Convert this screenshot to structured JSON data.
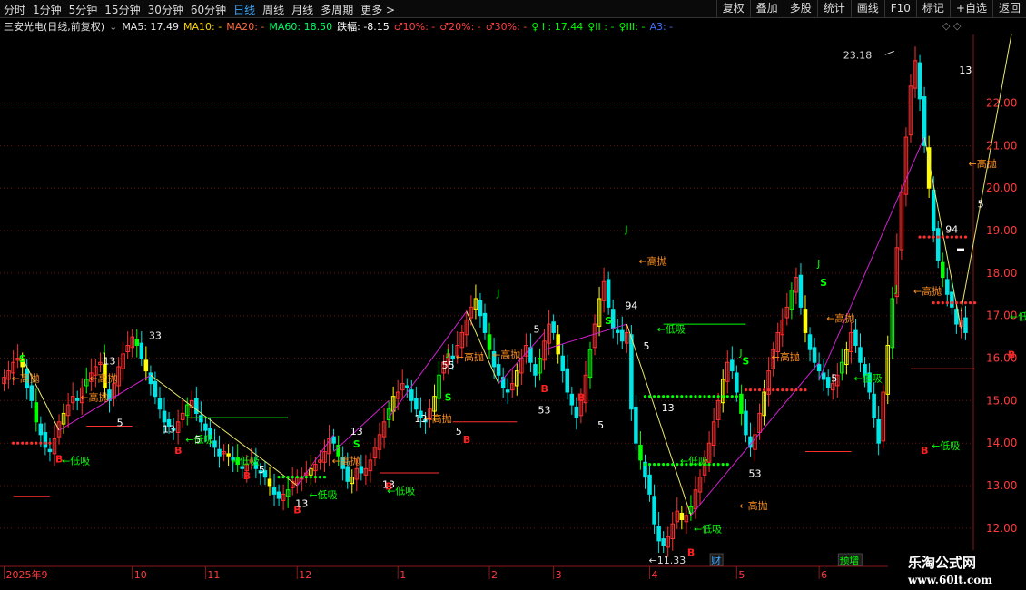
{
  "toolbar": {
    "period_tabs": [
      "分时",
      "1分钟",
      "5分钟",
      "15分钟",
      "30分钟",
      "60分钟",
      "日线",
      "周线",
      "月线",
      "多周期",
      "更多 >"
    ],
    "active_tab": "日线",
    "right_buttons": [
      "复权",
      "叠加",
      "多股",
      "统计",
      "画线",
      "F10",
      "标记",
      "+自选",
      "返回"
    ]
  },
  "info": {
    "stock_title": "三安光电(日线,前复权)",
    "ma5": "MA5: 17.49",
    "ma10": "MA10: -",
    "ma20": "MA20: -",
    "ma60": "MA60: 18.50",
    "change": "跌幅: -8.15",
    "f10": "♂10%: -",
    "f20": "♂20%: -",
    "f30": "♂30%: -",
    "l1": "♀ I : 17.44",
    "l2": "♀II : -",
    "l3": "♀III: -",
    "a3": "A3: -",
    "corner_icons": "◇ ◇"
  },
  "colors": {
    "up": "#ff3030",
    "down": "#00e5e5",
    "yellow": "#ffff00",
    "green": "#00ff00",
    "magenta": "#d020d0",
    "grid": "#6a1010",
    "orange": "#ff9020"
  },
  "chart_data": {
    "type": "candlestick",
    "ylim": [
      11.1,
      23.4
    ],
    "yticks": [
      12.0,
      13.0,
      14.0,
      15.0,
      16.0,
      17.0,
      18.0,
      19.0,
      20.0,
      21.0,
      22.0
    ],
    "ytick_labels": [
      "12.00",
      "13.00",
      "14.00",
      "15.00",
      "16.00",
      "17.00",
      "18.00",
      "19.00",
      "20.00",
      "21.00",
      "22.00"
    ],
    "x_labels": [
      {
        "i": 0,
        "label": "2025年9"
      },
      {
        "i": 28,
        "label": "10"
      },
      {
        "i": 44,
        "label": "11"
      },
      {
        "i": 64,
        "label": "12"
      },
      {
        "i": 86,
        "label": "1"
      },
      {
        "i": 106,
        "label": "2"
      },
      {
        "i": 120,
        "label": "3"
      },
      {
        "i": 141,
        "label": "4"
      },
      {
        "i": 160,
        "label": "5"
      },
      {
        "i": 178,
        "label": "6"
      }
    ],
    "bottom_tags": [
      {
        "i": 155,
        "label": "财",
        "color": "#3fa9ff"
      },
      {
        "i": 183,
        "label": "预增",
        "color": "#00ff00"
      }
    ],
    "high_label": {
      "i": 194,
      "text": "23.18"
    },
    "low_label": {
      "i": 140,
      "text": "11.33"
    },
    "closes": [
      15.55,
      15.7,
      15.9,
      16.0,
      15.8,
      15.3,
      15.0,
      14.5,
      14.2,
      13.9,
      13.8,
      14.1,
      14.5,
      14.7,
      14.9,
      15.1,
      15.0,
      15.3,
      15.5,
      15.65,
      15.8,
      15.9,
      15.3,
      15.0,
      15.4,
      15.8,
      16.1,
      16.3,
      16.5,
      16.3,
      16.0,
      15.7,
      15.4,
      15.1,
      14.8,
      14.5,
      14.4,
      14.3,
      14.5,
      14.7,
      14.9,
      15.0,
      14.7,
      14.5,
      14.3,
      14.1,
      13.9,
      13.7,
      13.8,
      13.7,
      13.6,
      13.5,
      13.4,
      13.5,
      13.6,
      13.4,
      13.3,
      13.2,
      13.0,
      12.8,
      12.7,
      12.8,
      12.9,
      13.1,
      13.2,
      13.2,
      13.3,
      13.4,
      13.5,
      13.6,
      13.8,
      14.1,
      14.0,
      13.7,
      13.4,
      13.1,
      13.2,
      13.4,
      13.3,
      13.4,
      13.6,
      13.9,
      14.2,
      14.5,
      14.8,
      15.1,
      15.2,
      15.4,
      15.3,
      15.0,
      14.8,
      14.6,
      14.5,
      14.8,
      15.1,
      15.6,
      15.9,
      16.1,
      16.0,
      16.3,
      16.6,
      16.9,
      17.2,
      17.4,
      17.0,
      16.6,
      16.2,
      15.8,
      15.6,
      15.3,
      15.2,
      15.4,
      15.7,
      16.0,
      16.3,
      15.9,
      15.6,
      16.0,
      16.4,
      16.8,
      16.6,
      16.1,
      15.7,
      15.2,
      14.9,
      14.6,
      15.0,
      15.6,
      16.2,
      16.8,
      17.4,
      17.8,
      17.2,
      16.7,
      16.6,
      16.4,
      16.6,
      14.8,
      14.0,
      13.6,
      13.2,
      12.8,
      12.1,
      11.7,
      11.6,
      11.8,
      12.1,
      12.4,
      12.2,
      12.3,
      12.5,
      12.9,
      13.2,
      13.6,
      14.0,
      14.5,
      15.0,
      15.5,
      15.9,
      15.7,
      15.2,
      14.7,
      14.2,
      13.9,
      14.2,
      14.7,
      15.2,
      15.7,
      16.2,
      16.6,
      16.9,
      17.2,
      17.6,
      17.9,
      17.2,
      16.6,
      16.2,
      15.9,
      15.7,
      15.5,
      15.3,
      15.4,
      15.6,
      15.9,
      16.2,
      16.6,
      16.3,
      15.9,
      15.6,
      15.2,
      14.6,
      14.0,
      15.2,
      16.3,
      17.4,
      18.6,
      19.9,
      21.2,
      22.4,
      23.0,
      22.1,
      21.0,
      20.0,
      19.0,
      18.3,
      17.9,
      17.5,
      17.2,
      16.8,
      16.9,
      16.6
    ]
  },
  "annotations": [
    {
      "kind": "S",
      "text": "S",
      "i": 4,
      "v": 15.9,
      "color": "#00ff00"
    },
    {
      "kind": "S",
      "text": "S",
      "i": 77,
      "v": 13.9,
      "color": "#00ff00"
    },
    {
      "kind": "S",
      "text": "S",
      "i": 97,
      "v": 15.0,
      "color": "#00ff00"
    },
    {
      "kind": "S",
      "text": "S",
      "i": 162,
      "v": 15.85,
      "color": "#00ff00"
    },
    {
      "kind": "S",
      "text": "S",
      "i": 179,
      "v": 17.7,
      "color": "#00ff00"
    },
    {
      "kind": "S",
      "text": "S",
      "i": 132,
      "v": 16.8,
      "color": "#00ff00"
    },
    {
      "kind": "B",
      "text": "B",
      "i": 12,
      "v": 13.55,
      "color": "#ff2020"
    },
    {
      "kind": "B",
      "text": "B",
      "i": 38,
      "v": 13.75,
      "color": "#ff2020"
    },
    {
      "kind": "B",
      "text": "B",
      "i": 53,
      "v": 13.15,
      "color": "#ff2020"
    },
    {
      "kind": "B",
      "text": "B",
      "i": 64,
      "v": 12.35,
      "color": "#ff2020"
    },
    {
      "kind": "B",
      "text": "B",
      "i": 84,
      "v": 12.9,
      "color": "#ff2020"
    },
    {
      "kind": "B",
      "text": "B",
      "i": 101,
      "v": 14.0,
      "color": "#ff2020"
    },
    {
      "kind": "B",
      "text": "B",
      "i": 118,
      "v": 15.2,
      "color": "#ff2020"
    },
    {
      "kind": "B",
      "text": "B",
      "i": 126,
      "v": 15.0,
      "color": "#ff2020"
    },
    {
      "kind": "B",
      "text": "B",
      "i": 150,
      "v": 11.35,
      "color": "#ff2020"
    },
    {
      "kind": "B",
      "text": "B",
      "i": 201,
      "v": 13.75,
      "color": "#ff2020"
    },
    {
      "kind": "B",
      "text": "B",
      "i": 220,
      "v": 16.0,
      "color": "#ff2020"
    },
    {
      "kind": "L",
      "text": "←低吸",
      "i": 13,
      "v": 13.5,
      "color": "#00ff00"
    },
    {
      "kind": "L",
      "text": "←低吸",
      "i": 40,
      "v": 14.0,
      "color": "#00ff00"
    },
    {
      "kind": "L",
      "text": "←低吸",
      "i": 50,
      "v": 13.5,
      "color": "#00ff00"
    },
    {
      "kind": "L",
      "text": "←低吸",
      "i": 67,
      "v": 12.7,
      "color": "#00ff00"
    },
    {
      "kind": "L",
      "text": "←低吸",
      "i": 84,
      "v": 12.8,
      "color": "#00ff00"
    },
    {
      "kind": "L",
      "text": "←低吸",
      "i": 143,
      "v": 16.6,
      "color": "#00ff00"
    },
    {
      "kind": "L",
      "text": "←低吸",
      "i": 148,
      "v": 13.5,
      "color": "#00ff00"
    },
    {
      "kind": "L",
      "text": "←低吸",
      "i": 151,
      "v": 11.9,
      "color": "#00ff00"
    },
    {
      "kind": "L",
      "text": "←低吸",
      "i": 186,
      "v": 15.45,
      "color": "#00ff00"
    },
    {
      "kind": "L",
      "text": "←低吸",
      "i": 203,
      "v": 13.85,
      "color": "#00ff00"
    },
    {
      "kind": "L",
      "text": "←低吸",
      "i": 220,
      "v": 16.9,
      "color": "#00ff00"
    },
    {
      "kind": "H",
      "text": "←高抛",
      "i": 2,
      "v": 15.45,
      "color": "#ff9020"
    },
    {
      "kind": "H",
      "text": "←高抛",
      "i": 17,
      "v": 15.0,
      "color": "#ff9020"
    },
    {
      "kind": "H",
      "text": "←高抛",
      "i": 19,
      "v": 15.45,
      "color": "#ff9020"
    },
    {
      "kind": "H",
      "text": "←高抛",
      "i": 72,
      "v": 13.5,
      "color": "#ff9020"
    },
    {
      "kind": "H",
      "text": "←高抛",
      "i": 92,
      "v": 14.5,
      "color": "#ff9020"
    },
    {
      "kind": "H",
      "text": "←高抛",
      "i": 99,
      "v": 15.95,
      "color": "#ff9020"
    },
    {
      "kind": "H",
      "text": "←高抛",
      "i": 107,
      "v": 16.0,
      "color": "#ff9020"
    },
    {
      "kind": "H",
      "text": "←高抛",
      "i": 139,
      "v": 18.2,
      "color": "#ff9020"
    },
    {
      "kind": "H",
      "text": "←高抛",
      "i": 161,
      "v": 12.45,
      "color": "#ff9020"
    },
    {
      "kind": "H",
      "text": "←高抛",
      "i": 168,
      "v": 15.95,
      "color": "#ff9020"
    },
    {
      "kind": "H",
      "text": "←高抛",
      "i": 180,
      "v": 16.85,
      "color": "#ff9020"
    },
    {
      "kind": "H",
      "text": "←高抛",
      "i": 199,
      "v": 17.5,
      "color": "#ff9020"
    },
    {
      "kind": "H",
      "text": "←高抛",
      "i": 211,
      "v": 20.5,
      "color": "#ff9020"
    },
    {
      "kind": "J",
      "text": "J",
      "i": 22,
      "v": 16.15,
      "color": "#00ff00"
    },
    {
      "kind": "J",
      "text": "J",
      "i": 97,
      "v": 16.05,
      "color": "#00ff00"
    },
    {
      "kind": "J",
      "text": "J",
      "i": 108,
      "v": 17.45,
      "color": "#00ff00"
    },
    {
      "kind": "J",
      "text": "J",
      "i": 136,
      "v": 18.95,
      "color": "#00ff00"
    },
    {
      "kind": "J",
      "text": "J",
      "i": 161,
      "v": 16.05,
      "color": "#00ff00"
    },
    {
      "kind": "J",
      "text": "J",
      "i": 178,
      "v": 18.15,
      "color": "#00ff00"
    },
    {
      "kind": "J",
      "text": "J",
      "i": 195,
      "v": 17.55,
      "color": "#00ff00"
    },
    {
      "kind": "N",
      "text": "13",
      "i": 22,
      "v": 15.85,
      "color": "#ffffff"
    },
    {
      "kind": "N",
      "text": "33",
      "i": 32,
      "v": 16.45,
      "color": "#ffffff"
    },
    {
      "kind": "N",
      "text": "13",
      "i": 35,
      "v": 14.25,
      "color": "#ffffff"
    },
    {
      "kind": "N",
      "text": "5",
      "i": 42,
      "v": 14.0,
      "color": "#ffffff"
    },
    {
      "kind": "N",
      "text": "5",
      "i": 25,
      "v": 14.4,
      "color": "#ffffff"
    },
    {
      "kind": "N",
      "text": "5",
      "i": 56,
      "v": 13.3,
      "color": "#ffffff"
    },
    {
      "kind": "N",
      "text": "13",
      "i": 76,
      "v": 14.2,
      "color": "#ffffff"
    },
    {
      "kind": "N",
      "text": "13",
      "i": 83,
      "v": 12.95,
      "color": "#ffffff"
    },
    {
      "kind": "N",
      "text": "13",
      "i": 64,
      "v": 12.5,
      "color": "#ffffff"
    },
    {
      "kind": "N",
      "text": "5",
      "i": 99,
      "v": 14.2,
      "color": "#ffffff"
    },
    {
      "kind": "N",
      "text": "55",
      "i": 96,
      "v": 15.75,
      "color": "#ffffff"
    },
    {
      "kind": "N",
      "text": "13",
      "i": 90,
      "v": 14.5,
      "color": "#ffffff"
    },
    {
      "kind": "N",
      "text": "5",
      "i": 116,
      "v": 16.6,
      "color": "#ffffff"
    },
    {
      "kind": "N",
      "text": "53",
      "i": 117,
      "v": 14.7,
      "color": "#ffffff"
    },
    {
      "kind": "N",
      "text": "5",
      "i": 130,
      "v": 14.35,
      "color": "#ffffff"
    },
    {
      "kind": "N",
      "text": "94",
      "i": 136,
      "v": 17.15,
      "color": "#ffffff"
    },
    {
      "kind": "N",
      "text": "5",
      "i": 140,
      "v": 16.2,
      "color": "#ffffff"
    },
    {
      "kind": "N",
      "text": "13",
      "i": 144,
      "v": 14.75,
      "color": "#ffffff"
    },
    {
      "kind": "N",
      "text": "53",
      "i": 163,
      "v": 13.2,
      "color": "#ffffff"
    },
    {
      "kind": "N",
      "text": "5",
      "i": 181,
      "v": 15.45,
      "color": "#ffffff"
    },
    {
      "kind": "N",
      "text": "94",
      "i": 206,
      "v": 18.95,
      "color": "#ffffff"
    },
    {
      "kind": "N",
      "text": "13",
      "i": 209,
      "v": 22.7,
      "color": "#ffffff"
    },
    {
      "kind": "N",
      "text": "5",
      "i": 213,
      "v": 19.55,
      "color": "#ffffff"
    }
  ]
}
